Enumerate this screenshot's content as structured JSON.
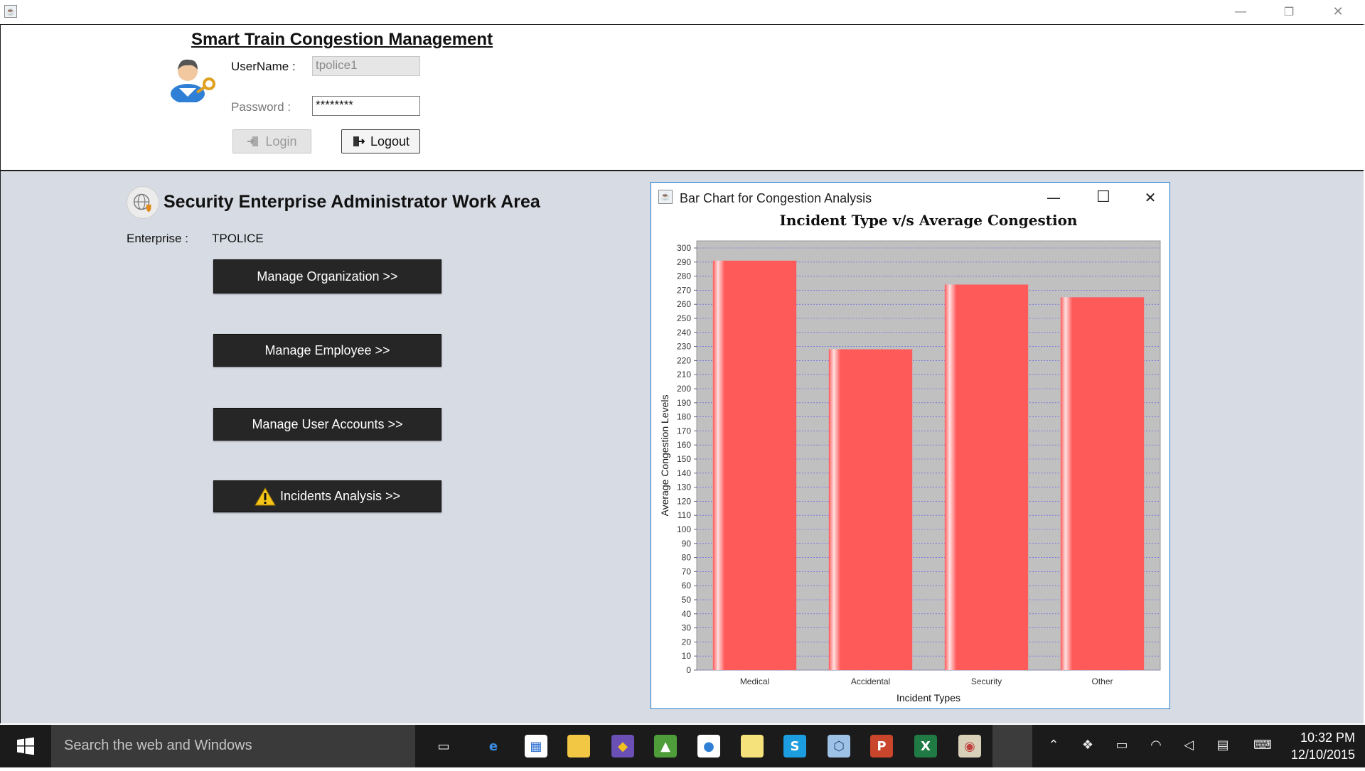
{
  "window": {
    "minimize_glyph": "—",
    "restore_glyph": "❐",
    "close_glyph": "✕"
  },
  "header": {
    "title": "Smart Train Congestion Management",
    "username_label": "UserName :",
    "username_value": "tpolice1",
    "password_label": "Password :",
    "password_value": "********",
    "login_label": "Login",
    "logout_label": "Logout"
  },
  "workarea": {
    "title": "Security Enterprise Administrator Work Area",
    "enterprise_label": "Enterprise :",
    "enterprise_value": "TPOLICE",
    "buttons": [
      {
        "label": "Manage Organization >>"
      },
      {
        "label": "Manage Employee >>"
      },
      {
        "label": "Manage User Accounts >>"
      },
      {
        "label": "Incidents Analysis >>",
        "icon": "warning-icon"
      }
    ]
  },
  "chart_window": {
    "title": "Bar Chart for Congestion Analysis"
  },
  "chart_data": {
    "type": "bar",
    "title": "Incident Type v/s Average Congestion",
    "xlabel": "Incident Types",
    "ylabel": "Average Congestion Levels",
    "categories": [
      "Medical",
      "Accidental",
      "Security",
      "Other"
    ],
    "values": [
      291,
      228,
      274,
      265
    ],
    "ylim": [
      0,
      300
    ],
    "ytick_step": 10,
    "grid": true,
    "bar_color": "#ff5a5a",
    "plot_bg": "#c0c0c0",
    "grid_color": "#3a3aff"
  },
  "taskbar": {
    "search_placeholder": "Search the web and Windows",
    "time": "10:32 PM",
    "date": "12/10/2015",
    "apps": [
      "task-view-icon",
      "edge-icon",
      "store-icon",
      "file-explorer-icon",
      "git-icon",
      "photo-app-icon",
      "chrome-icon",
      "sticky-notes-icon",
      "skype-icon",
      "virtualbox-icon",
      "powerpoint-icon",
      "excel-icon",
      "paint-icon",
      "java-icon"
    ]
  }
}
